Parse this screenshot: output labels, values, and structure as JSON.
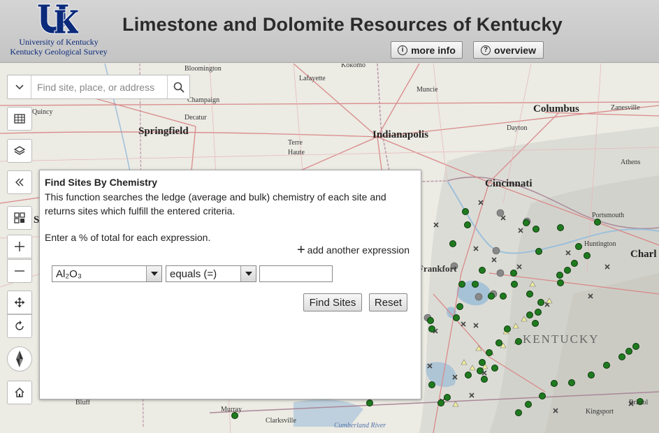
{
  "header": {
    "title": "Limestone and Dolomite Resources of Kentucky",
    "logo_line1": "University of Kentucky",
    "logo_line2": "Kentucky Geological Survey",
    "more_info_label": "more info",
    "overview_label": "overview",
    "brand_color": "#0b2a7a"
  },
  "search": {
    "placeholder": "Find site, place, or address"
  },
  "map_labels": {
    "bloomington": "Bloomington",
    "kokomo": "Kokomo",
    "lafayette": "Lafayette",
    "muncie": "Muncie",
    "columbus": "Columbus",
    "zanesville": "Zanesville",
    "quincy": "Quincy",
    "champaign": "Champaign",
    "decatur": "Decatur",
    "springfield": "Springfield",
    "indianapolis": "Indianapolis",
    "dayton": "Dayton",
    "terre_haute_1": "Terre",
    "terre_haute_2": "Haute",
    "athens": "Athens",
    "cincinnati": "Cincinnati",
    "portsmouth": "Portsmouth",
    "huntington": "Huntington",
    "charleston": "Charl",
    "frankfort": "Frankfort",
    "kentucky": "KENTUCKY",
    "bluff": "Bluff",
    "murray": "Murray",
    "clarksville": "Clarksville",
    "cumberland": "Cumberland River",
    "kingsport": "Kingsport",
    "bristol": "Bristol",
    "st": "St"
  },
  "panel": {
    "title": "Find Sites By Chemistry",
    "description": "This function searches the ledge (average and bulk) chemistry of each site and returns sites which fulfill the entered criteria.",
    "instruction": "Enter a % of total for each expression.",
    "add_expression": "add another expression",
    "chemical_selected": "Al₂O₃",
    "operator_selected": "equals (=)",
    "value": "",
    "find_label": "Find Sites",
    "reset_label": "Reset"
  },
  "colors": {
    "site_green": "#1f7a1f",
    "site_yellow": "#f0ee9a",
    "water": "#8fb6d6"
  }
}
